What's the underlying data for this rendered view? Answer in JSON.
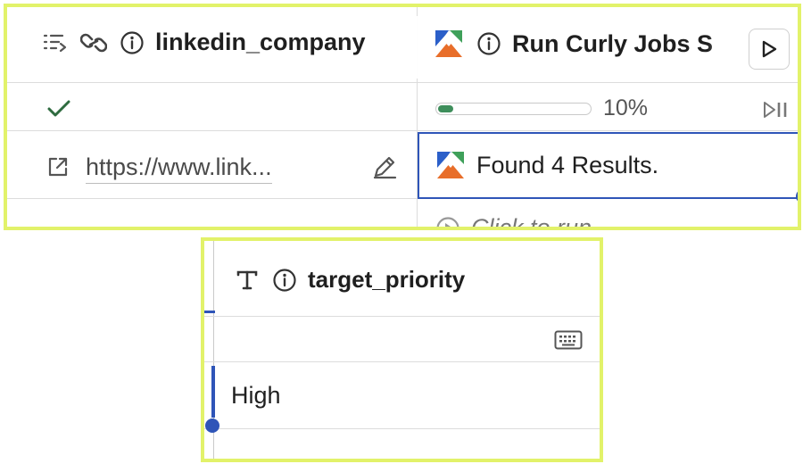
{
  "columns": {
    "linkedin": {
      "title": "linkedin_company",
      "row1_status": "checked",
      "row2_value": "https://www.link...",
      "icons": [
        "list-icon",
        "link-icon",
        "info-icon"
      ]
    },
    "run_curly": {
      "title": "Run Curly Jobs S",
      "progress_percent": 10,
      "progress_label": "10%",
      "row2_value": "Found 4 Results.",
      "row3_hint": "Click to run",
      "icons": [
        "app-logo-icon",
        "info-icon",
        "play-icon",
        "play-pause-icon"
      ]
    },
    "target_priority": {
      "title": "target_priority",
      "row2_value": "High",
      "icons": [
        "text-type-icon",
        "info-icon",
        "keyboard-icon"
      ]
    }
  },
  "colors": {
    "highlight_border": "#e2f26a",
    "selection_blue": "#2f55b8",
    "check_green": "#2e6b3f",
    "progress_green": "#3e8e5b",
    "logo_blue": "#2b5fc9",
    "logo_orange": "#e86e2a",
    "logo_green": "#3fa05a"
  }
}
